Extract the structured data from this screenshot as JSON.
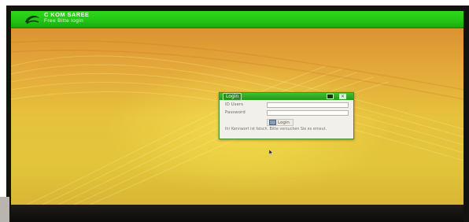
{
  "banner": {
    "brand_line1": "C KOM SAREE",
    "brand_line2": "Free Bitte login"
  },
  "login_dialog": {
    "title": "Login",
    "user_label": "ID Users",
    "password_label": "Password",
    "user_value": "",
    "password_value": "",
    "login_button_label": "Login",
    "status_message": "Ihr Kennwort ist falsch. Bitte versuchen Sie es erneut."
  },
  "colors": {
    "banner_green": "#22c414",
    "desktop_gold": "#e6c23d",
    "dialog_bg": "#f1f0ea"
  },
  "icons": {
    "logo": "brand-swoosh-icon",
    "minimize": "minimize-icon",
    "close": "close-icon",
    "login": "keyboard-icon",
    "cursor": "mouse-pointer-icon"
  }
}
